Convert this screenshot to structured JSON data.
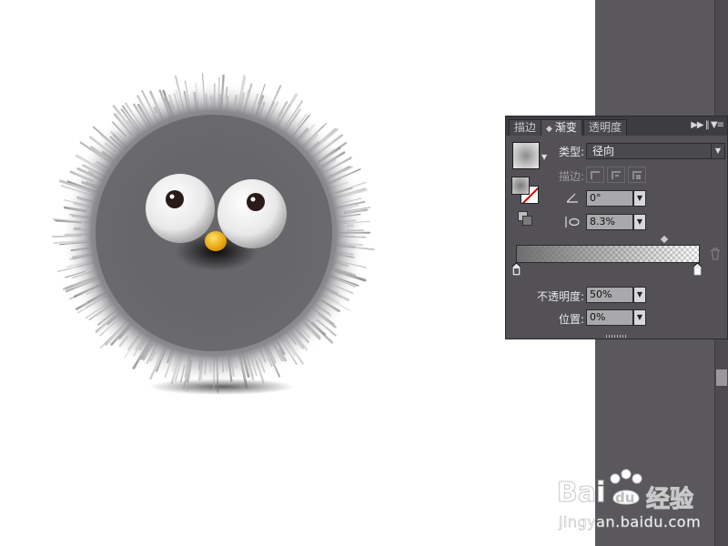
{
  "panel": {
    "tabs": [
      {
        "label": "描边",
        "active": false
      },
      {
        "label": "渐变",
        "active": true
      },
      {
        "label": "透明度",
        "active": false
      }
    ],
    "type_label": "类型:",
    "type_value": "径向",
    "stroke_label": "描边:",
    "angle_value": "0°",
    "aspect_value": "8.3%",
    "opacity_label": "不透明度:",
    "opacity_value": "50%",
    "location_label": "位置:",
    "location_value": "0%"
  },
  "watermark": {
    "brand_prefix": "Bai",
    "brand_suffix": "经验",
    "paw_text": "du",
    "url": "jingyan.baidu.com"
  },
  "colors": {
    "panel_bg": "#535155",
    "dock_bg": "#5a585c",
    "beak": "#f2b500",
    "fur": "#6b6a6e"
  }
}
